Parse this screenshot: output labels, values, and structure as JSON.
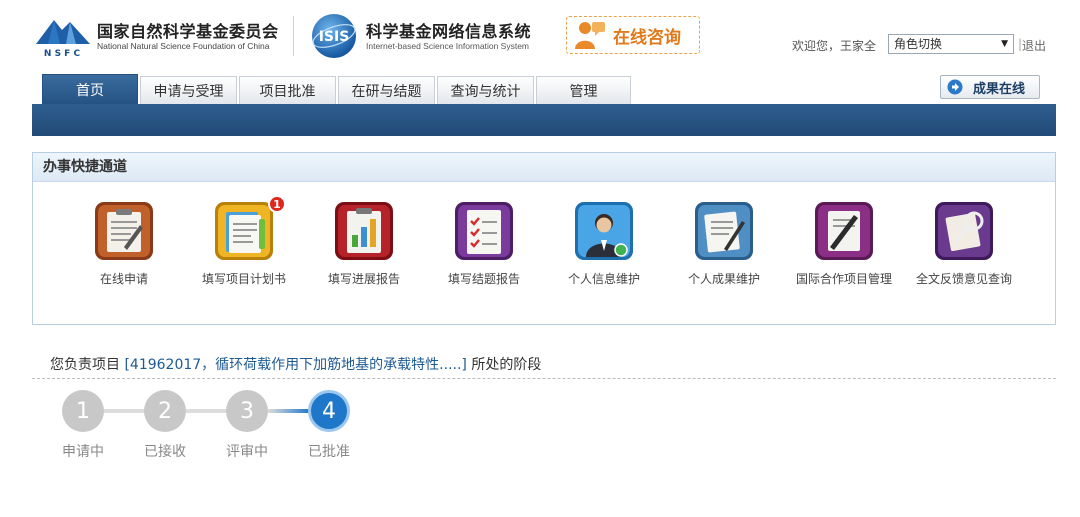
{
  "header": {
    "nsfc_name_cn": "国家自然科学基金委员会",
    "nsfc_name_en": "National Natural Science Foundation of China",
    "nsfc_logo_text": "N S F C",
    "isis_name_cn": "科学基金网络信息系统",
    "isis_name_en": "Internet-based Science Information System",
    "isis_logo_text": "ISIS",
    "consult_label": "在线咨询",
    "welcome_text": "欢迎您，王家全",
    "role_select_value": "角色切换",
    "logout_sep": "|",
    "logout_label": "退出"
  },
  "nav": {
    "tabs": [
      {
        "label": "首页",
        "active": true
      },
      {
        "label": "申请与受理",
        "active": false
      },
      {
        "label": "项目批准",
        "active": false
      },
      {
        "label": "在研与结题",
        "active": false
      },
      {
        "label": "查询与统计",
        "active": false
      },
      {
        "label": "管理",
        "active": false
      }
    ],
    "achievement_label": "成果在线"
  },
  "quick": {
    "title": "办事快捷通道",
    "items": [
      {
        "label": "在线申请",
        "icon": "online-apply-icon"
      },
      {
        "label": "填写项目计划书",
        "icon": "project-plan-icon",
        "badge": "1"
      },
      {
        "label": "填写进展报告",
        "icon": "progress-report-icon"
      },
      {
        "label": "填写结题报告",
        "icon": "final-report-icon"
      },
      {
        "label": "个人信息维护",
        "icon": "personal-info-icon"
      },
      {
        "label": "个人成果维护",
        "icon": "personal-achievement-icon"
      },
      {
        "label": "国际合作项目管理",
        "icon": "intl-cooperation-icon"
      },
      {
        "label": "全文反馈意见查询",
        "icon": "feedback-query-icon"
      }
    ]
  },
  "stage": {
    "prefix": "您负责项目 ",
    "project": "[41962017，循环荷载作用下加筋地基的承载特性.....]",
    "suffix": " 所处的阶段",
    "steps": [
      {
        "number": "1",
        "label": "申请中"
      },
      {
        "number": "2",
        "label": "已接收"
      },
      {
        "number": "3",
        "label": "评审中"
      },
      {
        "number": "4",
        "label": "已批准"
      }
    ],
    "current_step": 4
  },
  "colors": {
    "nav_blue": "#245283",
    "consult_orange": "#e17a1d",
    "step_inactive": "#c8c8c8",
    "step_active": "#1f77c9"
  }
}
